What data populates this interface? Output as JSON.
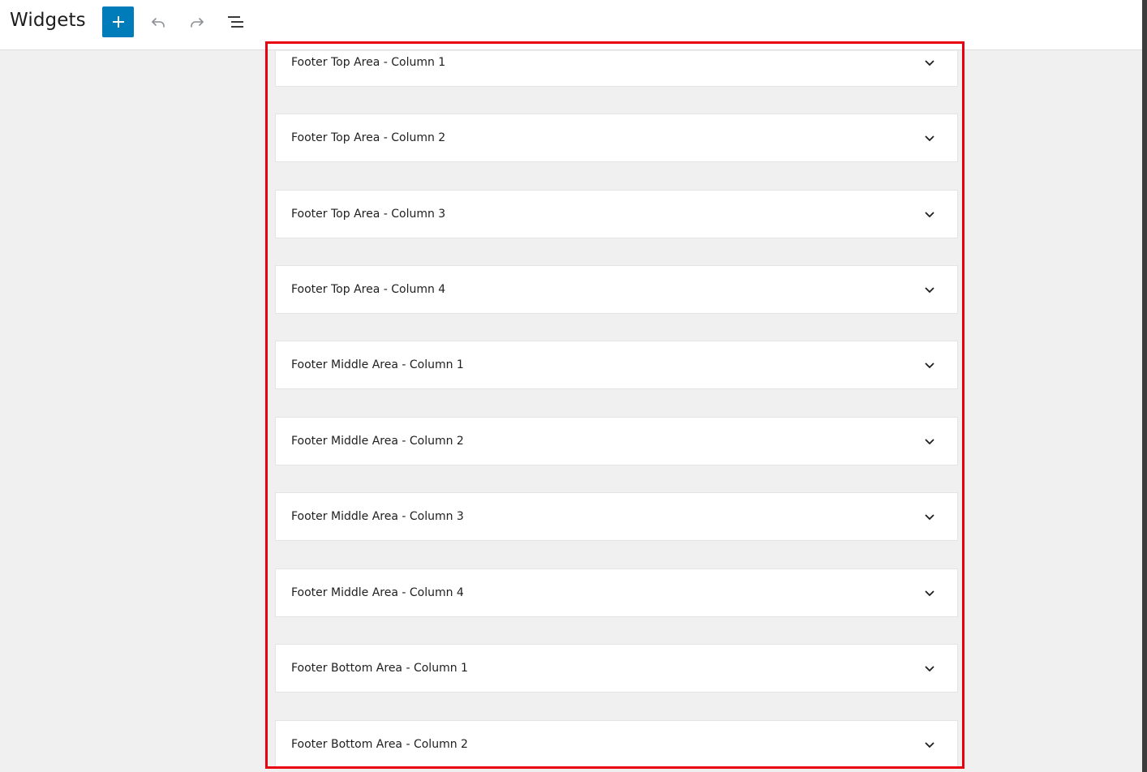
{
  "header": {
    "title": "Widgets",
    "add_icon": "plus-icon",
    "undo_icon": "undo-icon",
    "redo_icon": "redo-icon",
    "list_view_icon": "list-view-icon"
  },
  "colors": {
    "accent": "#007cba",
    "highlight": "#e8000f",
    "canvas_bg": "#f0f0f0"
  },
  "widget_areas": [
    {
      "label": "Footer Top Area - Column 1"
    },
    {
      "label": "Footer Top Area - Column 2"
    },
    {
      "label": "Footer Top Area - Column 3"
    },
    {
      "label": "Footer Top Area - Column 4"
    },
    {
      "label": "Footer Middle Area - Column 1"
    },
    {
      "label": "Footer Middle Area - Column 2"
    },
    {
      "label": "Footer Middle Area - Column 3"
    },
    {
      "label": "Footer Middle Area - Column 4"
    },
    {
      "label": "Footer Bottom Area - Column 1"
    },
    {
      "label": "Footer Bottom Area - Column 2"
    }
  ]
}
